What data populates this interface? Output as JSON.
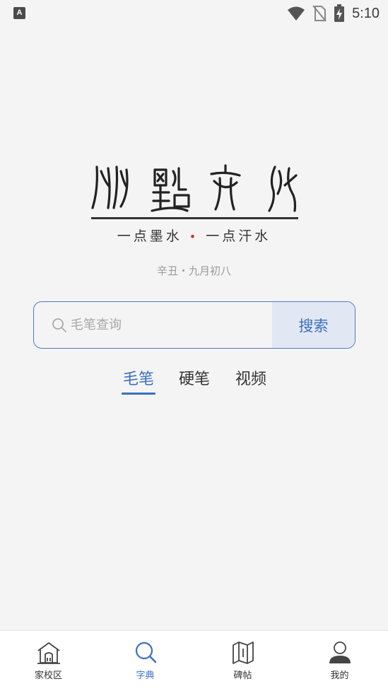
{
  "status_bar": {
    "app_icon_letter": "A",
    "time": "5:10",
    "icons": [
      "app-a-icon",
      "wifi-icon",
      "no-sim-icon",
      "battery-charging-icon"
    ]
  },
  "brand": {
    "logo_glyphs": "从點文化",
    "slogan_left": "一点墨水",
    "slogan_right": "一点汗水",
    "slogan_separator": "•",
    "lunar_date": "辛丑・九月初八"
  },
  "search": {
    "placeholder": "毛笔查询",
    "value": "",
    "button_label": "搜索"
  },
  "tabs": {
    "items": [
      {
        "label": "毛笔",
        "active": true
      },
      {
        "label": "硬笔",
        "active": false
      },
      {
        "label": "视频",
        "active": false
      }
    ]
  },
  "bottom_nav": {
    "items": [
      {
        "label": "家校区",
        "icon": "school-house-icon",
        "active": false
      },
      {
        "label": "字典",
        "icon": "search-icon",
        "active": true
      },
      {
        "label": "碑帖",
        "icon": "map-book-icon",
        "active": false
      },
      {
        "label": "我的",
        "icon": "user-icon",
        "active": false
      }
    ]
  },
  "colors": {
    "accent": "#3c6fbf",
    "background": "#f4f4f4",
    "slogan_dot": "#d0302b"
  }
}
